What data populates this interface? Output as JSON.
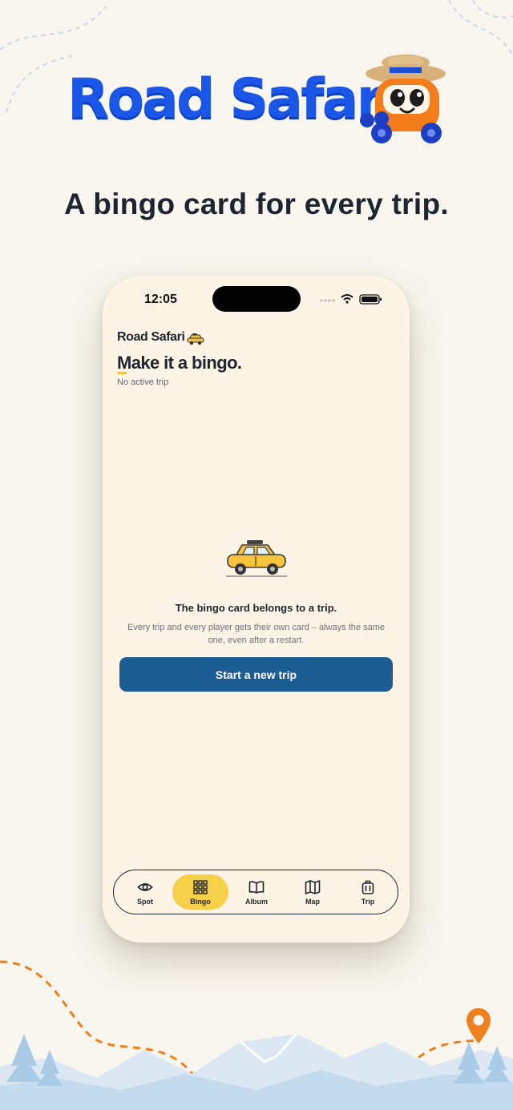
{
  "brand": {
    "title": "Road Safari"
  },
  "headline": "A bingo card for every trip.",
  "phone": {
    "status": {
      "time": "12:05"
    },
    "header": {
      "app_name": "Road Safari",
      "title": "Make it a bingo.",
      "subtitle": "No active trip"
    },
    "empty_state": {
      "title": "The bingo card belongs to a trip.",
      "description": "Every trip and every player gets their own card – always the same one, even after a restart.",
      "button_label": "Start a new trip"
    },
    "tabs": [
      {
        "label": "Spot",
        "icon": "eye-icon",
        "active": false
      },
      {
        "label": "Bingo",
        "icon": "grid-icon",
        "active": true
      },
      {
        "label": "Album",
        "icon": "book-icon",
        "active": false
      },
      {
        "label": "Map",
        "icon": "map-icon",
        "active": false
      },
      {
        "label": "Trip",
        "icon": "suitcase-icon",
        "active": false
      }
    ]
  },
  "colors": {
    "background": "#f8f6ee",
    "brand_blue": "#1a56e8",
    "button": "#1b5c92",
    "tab_active": "#f7d04a",
    "route_orange": "#f07f1e"
  }
}
